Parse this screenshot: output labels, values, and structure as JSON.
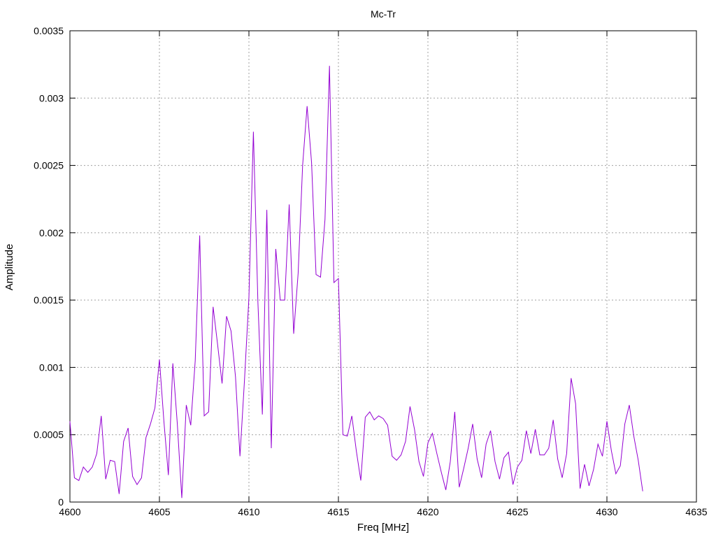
{
  "chart_data": {
    "type": "line",
    "title": "Mc-Tr",
    "xlabel": "Freq [MHz]",
    "ylabel": "Amplitude",
    "xlim": [
      4600,
      4635
    ],
    "ylim": [
      0,
      0.0035
    ],
    "xticks": [
      "4600",
      "4605",
      "4610",
      "4615",
      "4620",
      "4625",
      "4630",
      "4635"
    ],
    "yticks": [
      "0",
      "0.0005",
      "0.001",
      "0.0015",
      "0.002",
      "0.0025",
      "0.003",
      "0.0035"
    ],
    "grid": true,
    "series": [
      {
        "color": "#9400d3",
        "x": [
          4600.0,
          4600.25,
          4600.5,
          4600.75,
          4601.0,
          4601.25,
          4601.5,
          4601.75,
          4602.0,
          4602.25,
          4602.5,
          4602.75,
          4603.0,
          4603.25,
          4603.5,
          4603.75,
          4604.0,
          4604.25,
          4604.5,
          4604.75,
          4605.0,
          4605.25,
          4605.5,
          4605.75,
          4606.0,
          4606.25,
          4606.5,
          4606.75,
          4607.0,
          4607.25,
          4607.5,
          4607.75,
          4608.0,
          4608.25,
          4608.5,
          4608.75,
          4609.0,
          4609.25,
          4609.5,
          4609.75,
          4610.0,
          4610.25,
          4610.5,
          4610.75,
          4611.0,
          4611.25,
          4611.5,
          4611.75,
          4612.0,
          4612.25,
          4612.5,
          4612.75,
          4613.0,
          4613.25,
          4613.5,
          4613.75,
          4614.0,
          4614.25,
          4614.5,
          4614.75,
          4615.0,
          4615.25,
          4615.5,
          4615.75,
          4616.0,
          4616.25,
          4616.5,
          4616.75,
          4617.0,
          4617.25,
          4617.5,
          4617.75,
          4618.0,
          4618.25,
          4618.5,
          4618.75,
          4619.0,
          4619.25,
          4619.5,
          4619.75,
          4620.0,
          4620.25,
          4620.5,
          4620.75,
          4621.0,
          4621.25,
          4621.5,
          4621.75,
          4622.0,
          4622.25,
          4622.5,
          4622.75,
          4623.0,
          4623.25,
          4623.5,
          4623.75,
          4624.0,
          4624.25,
          4624.5,
          4624.75,
          4625.0,
          4625.25,
          4625.5,
          4625.75,
          4626.0,
          4626.25,
          4626.5,
          4626.75,
          4627.0,
          4627.25,
          4627.5,
          4627.75,
          4628.0,
          4628.25,
          4628.5,
          4628.75,
          4629.0,
          4629.25,
          4629.5,
          4629.75,
          4630.0,
          4630.25,
          4630.5,
          4630.75,
          4631.0,
          4631.25,
          4631.5,
          4631.75,
          4632.0
        ],
        "y": [
          0.0006,
          0.00018,
          0.00016,
          0.00026,
          0.00022,
          0.00026,
          0.00036,
          0.00064,
          0.00017,
          0.00031,
          0.0003,
          6e-05,
          0.00045,
          0.00055,
          0.00019,
          0.00013,
          0.00018,
          0.00048,
          0.00058,
          0.0007,
          0.00106,
          0.0006,
          0.0002,
          0.00103,
          0.00058,
          3e-05,
          0.00072,
          0.00057,
          0.00105,
          0.00198,
          0.00064,
          0.00067,
          0.00145,
          0.00117,
          0.00088,
          0.00138,
          0.00127,
          0.00093,
          0.00034,
          0.0009,
          0.00152,
          0.00275,
          0.00149,
          0.00065,
          0.00217,
          0.0004,
          0.00188,
          0.0015,
          0.0015,
          0.00221,
          0.00125,
          0.0017,
          0.0025,
          0.00294,
          0.00252,
          0.00169,
          0.00167,
          0.0021,
          0.00324,
          0.00163,
          0.00166,
          0.0005,
          0.00049,
          0.00064,
          0.00038,
          0.00016,
          0.00063,
          0.00067,
          0.00061,
          0.00064,
          0.00062,
          0.00057,
          0.00034,
          0.00031,
          0.00035,
          0.00045,
          0.00071,
          0.00054,
          0.0003,
          0.00019,
          0.00044,
          0.00051,
          0.00036,
          0.00022,
          9e-05,
          0.0003,
          0.00067,
          0.00011,
          0.00025,
          0.0004,
          0.00058,
          0.00032,
          0.00018,
          0.00043,
          0.00053,
          0.0003,
          0.00017,
          0.00033,
          0.00037,
          0.00013,
          0.00026,
          0.00031,
          0.00053,
          0.00036,
          0.00054,
          0.00035,
          0.00035,
          0.0004,
          0.00061,
          0.00032,
          0.00018,
          0.00036,
          0.00092,
          0.00073,
          0.0001,
          0.00028,
          0.00012,
          0.00024,
          0.00043,
          0.00034,
          0.0006,
          0.00038,
          0.00021,
          0.00027,
          0.00058,
          0.00072,
          0.00049,
          0.00031,
          8e-05
        ]
      }
    ]
  }
}
